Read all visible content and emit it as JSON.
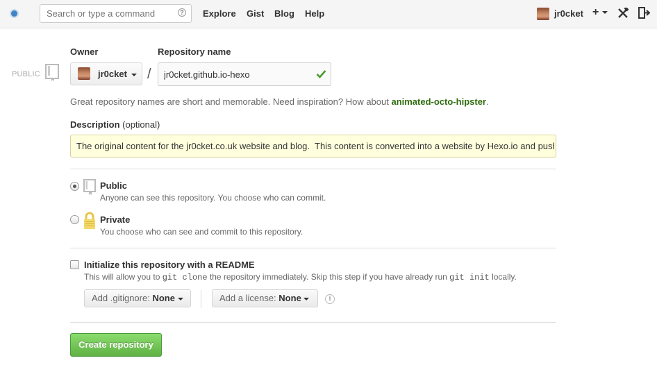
{
  "header": {
    "search_placeholder": "Search or type a command",
    "search_help": "?",
    "nav": [
      "Explore",
      "Gist",
      "Blog",
      "Help"
    ],
    "username": "jr0cket",
    "create_new": "+",
    "settings_icon": "tools-icon",
    "signout_icon": "sign-out-icon"
  },
  "form": {
    "visibility_tag": "PUBLIC",
    "owner_label": "Owner",
    "owner_value": "jr0cket",
    "separator": "/",
    "repo_label": "Repository name",
    "repo_value": "jr0cket.github.io-hexo",
    "hint_prefix": "Great repository names are short and memorable. Need inspiration? How about ",
    "hint_suggestion": "animated-octo-hipster",
    "hint_suffix": ".",
    "description_label": "Description",
    "description_optional": "(optional)",
    "description_value": "The original content for the jr0cket.co.uk website and blog.  This content is converted into a website by Hexo.io and pushed to",
    "public_title": "Public",
    "public_desc": "Anyone can see this repository. You choose who can commit.",
    "private_title": "Private",
    "private_desc": "You choose who can see and commit to this repository.",
    "selected_visibility": "Public",
    "readme_title": "Initialize this repository with a README",
    "readme_desc_1": "This will allow you to ",
    "readme_code_1": "git clone",
    "readme_desc_2": " the repository immediately. Skip this step if you have already run ",
    "readme_code_2": "git init",
    "readme_desc_3": " locally.",
    "readme_checked": false,
    "gitignore_label": "Add .gitignore:",
    "gitignore_value": "None",
    "license_label": "Add a license:",
    "license_value": "None",
    "info": "i",
    "create_button": "Create repository"
  },
  "colors": {
    "accent_blue": "#4183c4",
    "suggestion_green": "#2f6d0f",
    "button_green": "#60b044",
    "description_bg": "#ffffdd"
  }
}
